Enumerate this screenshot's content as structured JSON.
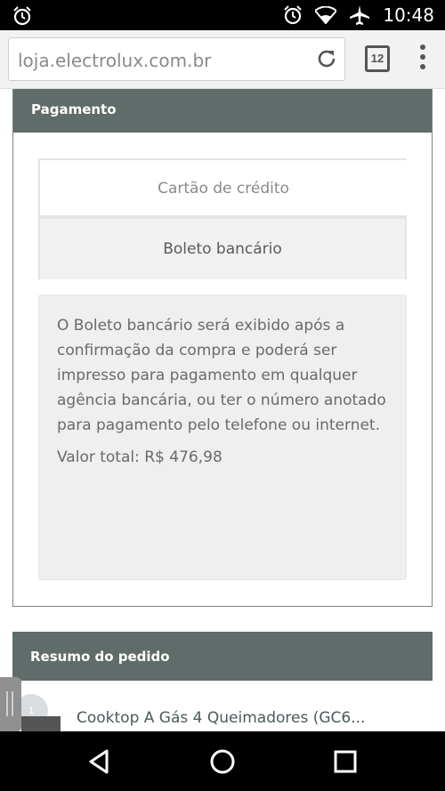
{
  "status_bar": {
    "time": "10:48",
    "icons": [
      "alarm-icon",
      "alarm-icon",
      "wifi-icon",
      "airplane-mode-icon"
    ]
  },
  "browser": {
    "url": "loja.electrolux.com.br",
    "tab_count": "12"
  },
  "payment": {
    "header": "Pagamento",
    "options": [
      {
        "label": "Cartão de crédito"
      },
      {
        "label": "Boleto bancário"
      }
    ],
    "description": "O Boleto bancário será exibido após a confirmação da compra e poderá ser impresso para pagamento em qualquer agência bancária, ou ter o número anotado para pagamento pelo telefone ou internet.",
    "total": "Valor total: R$ 476,98"
  },
  "summary": {
    "header": "Resumo do pedido",
    "item": {
      "quantity": "1",
      "name": "Cooktop A Gás 4 Queimadores (GC6..."
    }
  },
  "colors": {
    "header_bg": "#606c6a",
    "panel_border": "#7a8482",
    "info_bg": "#efefef"
  }
}
